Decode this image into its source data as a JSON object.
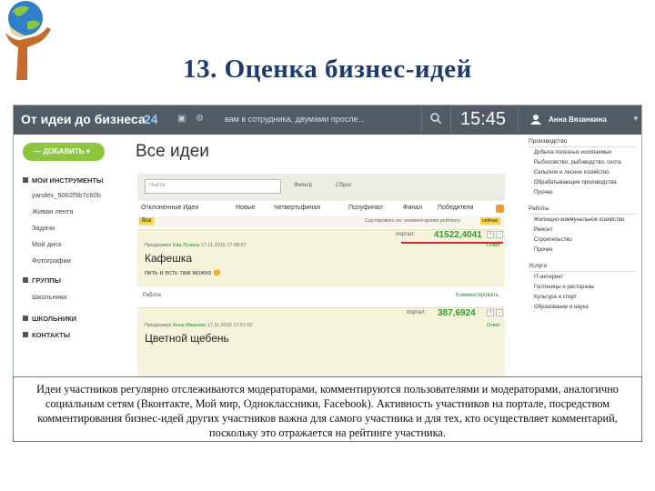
{
  "slide": {
    "title": "13. Оценка бизнес-идей",
    "caption": "Идеи участников регулярно отслеживаются модераторами, комментируются пользователями и модераторами, аналогично социальным сетям (Вконтакте, Мой мир, Одноклассники, Facebook). Активность участников на портале, посредством комментирования бизнес-идей других участников важна для самого участника и для тех, кто осуществляет комментарий, поскольку это отражается на рейтинге участника."
  },
  "topbar": {
    "brand": "От идеи до бизнеса",
    "count": "24",
    "ticker": "вам в сотрудника, двумами просле...",
    "time": "15:45",
    "user": "Анна Вязанкина"
  },
  "sidebar": {
    "add_button": "ДОБАВИТЬ",
    "tools_head": "МОИ ИНСТРУМЕНТЫ",
    "tools": [
      "yandex_5062f5b7c60b",
      "Живая лента",
      "Задачи",
      "Мой диск",
      "Фотографии"
    ],
    "groups_head": "ГРУППЫ",
    "groups": [
      "Школьники"
    ],
    "school_head": "ШКОЛЬНИКИ",
    "contacts_head": "КОНТАКТЫ"
  },
  "main": {
    "heading": "Все идеи",
    "filter_placeholder": "Найти",
    "filter_links": [
      "Фильтр",
      "Сброс"
    ],
    "tabs": [
      "Отклоненные Идеи",
      "Новые",
      "Четвертьфинал",
      "Полуфинал",
      "Финал",
      "Победители"
    ],
    "subbar": {
      "all": "Все",
      "sort": "Сортировать по: комментариям  рейтингу",
      "now": "сейчас"
    },
    "ideas": [
      {
        "portal": "портал:",
        "score": "41522,4041",
        "author_label": "Предложил",
        "author": "Ева Лузина",
        "date": "17.11.2015 17:08:57",
        "reply": "Ответ",
        "name": "Кафешка",
        "desc": "пить и есть там можно 😊",
        "meta_left": "Работа",
        "meta_right": "Комментировать"
      },
      {
        "portal": "портал:",
        "score": "387,6924",
        "author_label": "Предложил",
        "author": "Анна Иванова",
        "date": "17.11.2015 17:57:02",
        "reply": "Ответ",
        "name": "Цветной щебень",
        "desc": "",
        "meta_left": "",
        "meta_right": ""
      }
    ]
  },
  "right": {
    "sections": [
      {
        "head": "Производство",
        "items": [
          "Добыча полезных ископаемых",
          "Рыболовство, рыбоводство, охота",
          "Сельское и лесное хозяйство",
          "Обрабатывающие производства",
          "Прочее"
        ]
      },
      {
        "head": "Работы",
        "items": [
          "Жилищно-коммунальное хозяйство",
          "Ремонт",
          "Строительство",
          "Прочее"
        ]
      },
      {
        "head": "Услуги",
        "items": [
          "IT-интернет",
          "Гостиницы и рестораны",
          "Культура и спорт",
          "Образование и наука"
        ]
      }
    ]
  },
  "colors": {
    "topbar": "#525a63",
    "accent_green": "#8cc63f",
    "title_blue": "#1f3b6b",
    "score_green": "#2e9a2e",
    "highlight": "#f5d34f"
  }
}
